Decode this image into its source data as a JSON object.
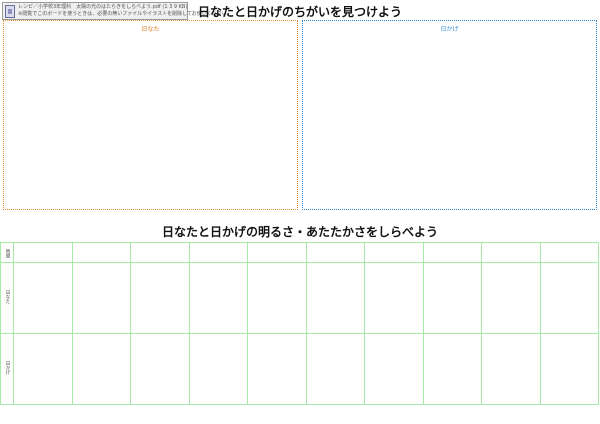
{
  "attachment": {
    "line1": "レンピ／小学校3年理科　太陽の光のはたらきをしらべよう.pdf (1 3 9 KB)",
    "line2": "※閲覧でこのボードを使うときは、必要の無いファイルやイラストを削除してお使いください。"
  },
  "page": {
    "title": "日なたと日かげのちがいを見つけよう",
    "subtitle": "日なたと日かげの明るさ・あたたかさをしらべよう"
  },
  "panels": {
    "left_label": "日なた",
    "right_label": "日かげ"
  },
  "table": {
    "row_labels": [
      "時間",
      "日なた",
      "日かげ"
    ],
    "data_columns": 10
  },
  "colors": {
    "sun_border": "#f08c32",
    "shade_border": "#2a84d2",
    "grid_line": "#a8eaa8"
  }
}
